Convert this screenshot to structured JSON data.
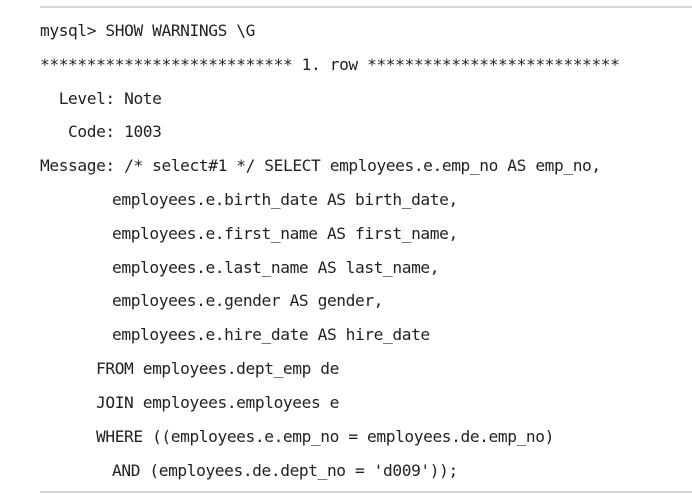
{
  "terminal": {
    "prompt_line": "mysql> SHOW WARNINGS \\G",
    "row_separator": "*************************** 1. row ***************************",
    "level_line": "  Level: Note",
    "code_line": "   Code: 1003",
    "message_line": "Message: /* select#1 */ SELECT employees.e.emp_no AS emp_no,",
    "cont_birth": "          employees.e.birth_date AS birth_date,",
    "cont_first": "          employees.e.first_name AS first_name,",
    "cont_last": "          employees.e.last_name AS last_name,",
    "cont_gender": "          employees.e.gender AS gender,",
    "cont_hire": "          employees.e.hire_date AS hire_date",
    "from_line": "    FROM employees.dept_emp de",
    "join_line": "      JOIN employees.employees e",
    "where_line": "    WHERE ((employees.e.emp_no = employees.de.emp_no)",
    "and_line": "          AND (employees.de.dept_no = 'd009'));"
  },
  "colors": {
    "text": "#222222",
    "background": "#ffffff",
    "rule": "#d7d7d7"
  }
}
